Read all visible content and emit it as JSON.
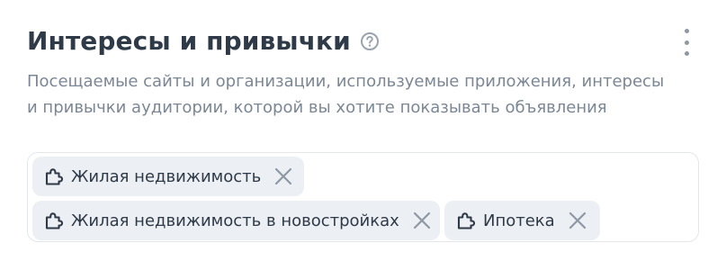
{
  "section": {
    "title": "Интересы и привычки",
    "description_lines": [
      "Посещаемые сайты и организации, используемые приложения, интересы",
      "и привычки аудитории, которой вы хотите показывать объявления"
    ]
  },
  "tags": [
    {
      "label": "Жилая недвижимость",
      "icon": "puzzle-icon"
    },
    {
      "label": "Жилая недвижимость в новостройках",
      "icon": "puzzle-icon"
    },
    {
      "label": "Ипотека",
      "icon": "puzzle-icon"
    }
  ],
  "icons": {
    "help": "question-circle-icon",
    "menu": "more-vertical-icon",
    "remove": "close-icon"
  },
  "colors": {
    "title": "#2f3a48",
    "description": "#7b8794",
    "chip_background": "#eceff3",
    "chip_text": "#2f3a48",
    "remove_icon": "#8e98a4",
    "border": "#e3e7ec"
  }
}
